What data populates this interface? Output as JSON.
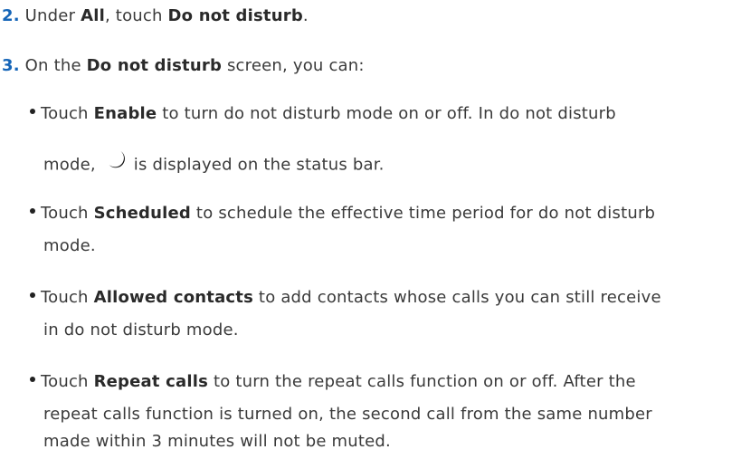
{
  "step2": {
    "number": "2.",
    "t1": " Under ",
    "b1": "All",
    "t2": ", touch ",
    "b2": "Do not disturb",
    "t3": "."
  },
  "step3": {
    "number": "3.",
    "t1": " On the ",
    "b1": "Do not disturb",
    "t2": " screen, you can:"
  },
  "bullets": [
    {
      "t1": "Touch ",
      "b1": "Enable",
      "l1": " to turn do not disturb mode on or off. In do not disturb",
      "l2a": "mode,",
      "l2b": "is displayed on the status bar.",
      "icon": "moon-icon"
    },
    {
      "t1": "Touch ",
      "b1": "Scheduled",
      "l1": " to schedule the effective time period for do not disturb",
      "l2": "mode."
    },
    {
      "t1": "Touch ",
      "b1": "Allowed contacts",
      "l1": " to add contacts whose calls you can still receive",
      "l2": "in do not disturb mode."
    },
    {
      "t1": "Touch ",
      "b1": "Repeat calls",
      "l1": " to turn the repeat calls function on or off. After the",
      "l2": "repeat calls function is turned on, the second call from the same number",
      "l3": "made within 3 minutes will not be muted."
    }
  ],
  "colors": {
    "step_number": "#1565b8",
    "text": "#3a3a3a"
  }
}
